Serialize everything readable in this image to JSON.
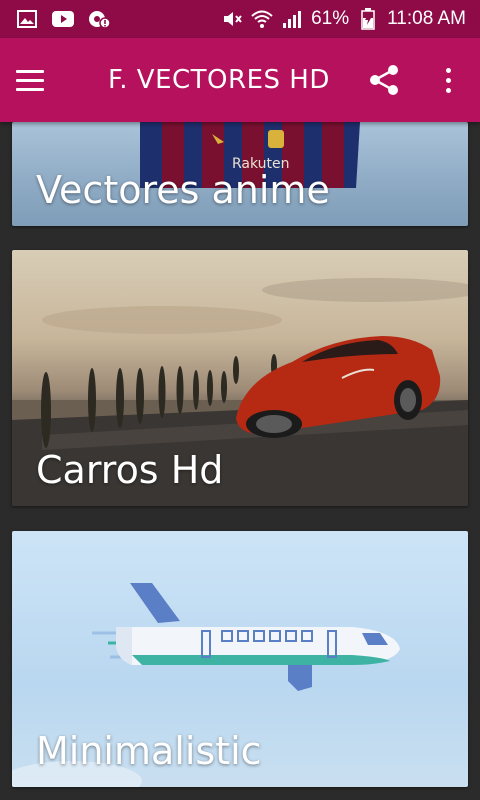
{
  "status_bar": {
    "battery": "61%",
    "time": "11:08 AM"
  },
  "app_bar": {
    "title": "F. VECTORES HD"
  },
  "cards": [
    {
      "label": "Vectores anime"
    },
    {
      "label": "Carros Hd"
    },
    {
      "label": "Minimalistic"
    }
  ],
  "colors": {
    "status_bar": "#8e0b47",
    "app_bar": "#b5115c",
    "background": "#2b2b2b"
  }
}
